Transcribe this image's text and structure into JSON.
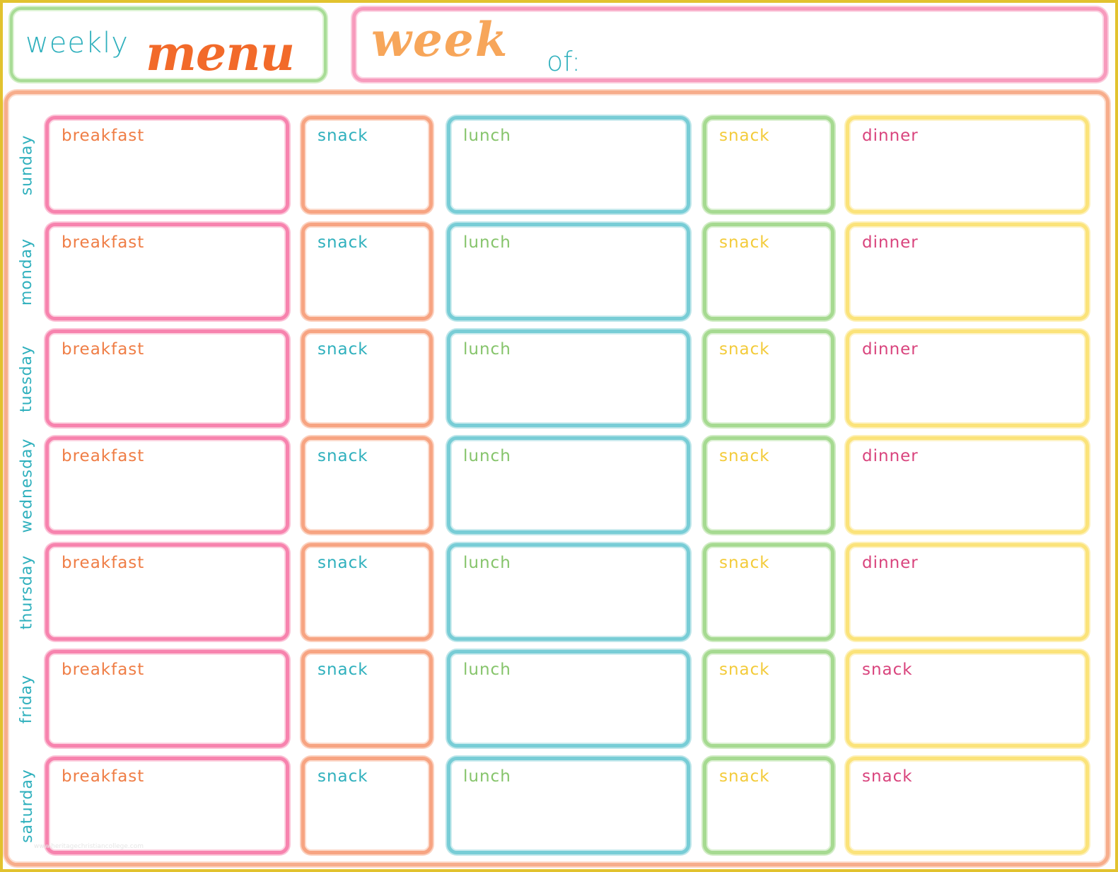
{
  "header": {
    "title_weekly": "weekly",
    "title_menu": "menu",
    "week_word": "week",
    "of_word": "of:",
    "week_of_value": ""
  },
  "colors": {
    "frame": "#e2c22e",
    "teal": "#2fb0bd",
    "orange_title": "#f26a2a",
    "week_orange": "#f7a65a",
    "breakfast_text": "#ef7d45",
    "snack1_text": "#2fb0bd",
    "lunch_text": "#86c46b",
    "snack2_text": "#f3cb3a",
    "dinner_text": "#d9447d"
  },
  "days": [
    {
      "name": "sunday",
      "meals": [
        "breakfast",
        "snack",
        "lunch",
        "snack",
        "dinner"
      ]
    },
    {
      "name": "monday",
      "meals": [
        "breakfast",
        "snack",
        "lunch",
        "snack",
        "dinner"
      ]
    },
    {
      "name": "tuesday",
      "meals": [
        "breakfast",
        "snack",
        "lunch",
        "snack",
        "dinner"
      ]
    },
    {
      "name": "wednesday",
      "meals": [
        "breakfast",
        "snack",
        "lunch",
        "snack",
        "dinner"
      ]
    },
    {
      "name": "thursday",
      "meals": [
        "breakfast",
        "snack",
        "lunch",
        "snack",
        "dinner"
      ]
    },
    {
      "name": "friday",
      "meals": [
        "breakfast",
        "snack",
        "lunch",
        "snack",
        "snack"
      ]
    },
    {
      "name": "saturday",
      "meals": [
        "breakfast",
        "snack",
        "lunch",
        "snack",
        "snack"
      ]
    }
  ],
  "watermark": "www.heritagechristiancollege.com"
}
